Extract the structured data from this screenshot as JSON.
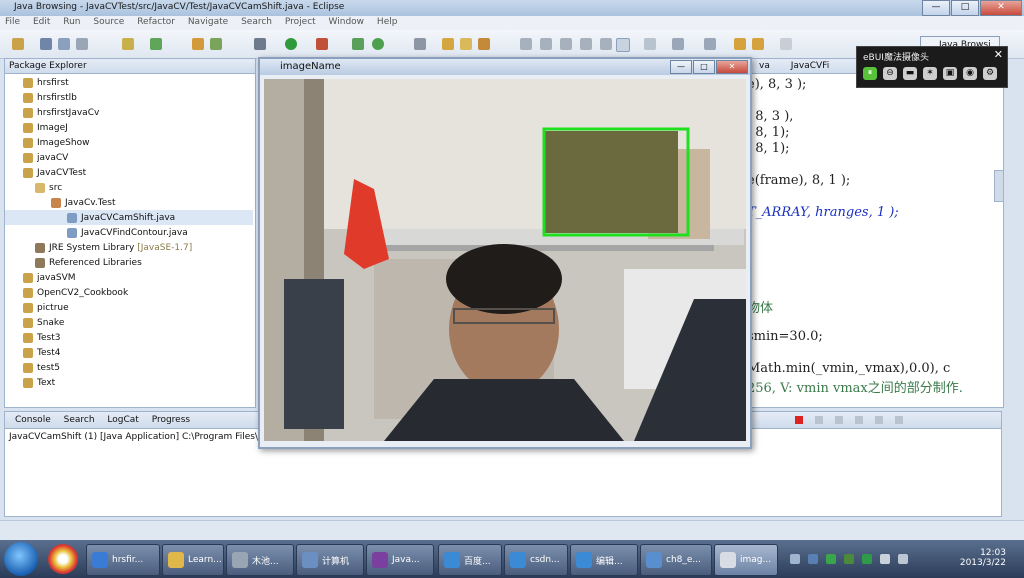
{
  "window": {
    "title": "Java Browsing - JavaCVTest/src/JavaCV/Test/JavaCVCamShift.java - Eclipse",
    "min": "—",
    "max": "□",
    "close": "✕"
  },
  "menu": [
    "File",
    "Edit",
    "Run",
    "Source",
    "Refactor",
    "Navigate",
    "Search",
    "Project",
    "Window",
    "Help"
  ],
  "perspective": "Java Browsi",
  "package_explorer": {
    "title": "Package Explorer",
    "items": [
      "hrsfirst",
      "hrsfirstlb",
      "hrsfirstJavaCv",
      "ImageJ",
      "ImageShow",
      "javaCV",
      "JavaCVTest",
      "src",
      "JavaCv.Test",
      "JavaCVCamShift.java",
      "JavaCVFindContour.java",
      "JRE System Library",
      "[JavaSE-1.7]",
      "Referenced Libraries",
      "javaSVM",
      "OpenCV2_Cookbook",
      "pictrue",
      "Snake",
      "Test3",
      "Test4",
      "test5",
      "Text"
    ]
  },
  "editor": {
    "tabs": [
      "va",
      "JavaCVFi"
    ],
    "lines": [
      "e), 8, 3 );",
      ", 8, 3 ),",
      ", 8, 1);",
      ", 8, 1);",
      "e(frame), 8, 1 );",
      "T_ARRAY, hranges, 1 );",
      "物体",
      "smin=30.0;",
      "Math.min(_vmin,_vmax),0.0), c",
      "256, V: vmin vmax之间的部分制作."
    ]
  },
  "console": {
    "tabs": [
      "Console",
      "Search",
      "LogCat",
      "Progress"
    ],
    "text": "JavaCVCamShift (1) [Java Application] C:\\Program Files\\Ja"
  },
  "image_window": {
    "title": "imageName",
    "min": "—",
    "max": "□",
    "close": "✕"
  },
  "cam_widget": {
    "title": "eBUI魔法摄像头",
    "close": "✕",
    "buttons": [
      "⏸",
      "⊖",
      "▬",
      "✶",
      "▣",
      "◉",
      "⚙"
    ]
  },
  "taskbar": {
    "items": [
      "hrsfir...",
      "Learn...",
      "木池...",
      "计算机",
      "Java...",
      "百度...",
      "csdn...",
      "编辑...",
      "ch8_e...",
      "imag..."
    ],
    "clock_time": "12:03",
    "clock_date": "2013/3/22"
  }
}
